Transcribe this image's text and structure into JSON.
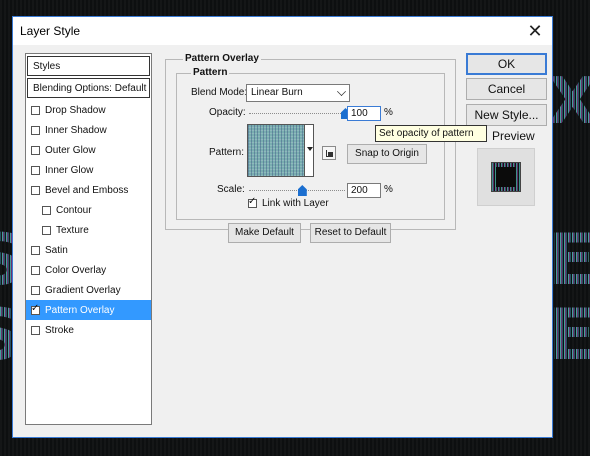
{
  "window": {
    "title": "Layer Style",
    "close_glyph": "✕"
  },
  "styles_list": {
    "header": "Styles",
    "blending_options": "Blending Options: Default",
    "items": [
      {
        "label": "Drop Shadow",
        "checked": false
      },
      {
        "label": "Inner Shadow",
        "checked": false
      },
      {
        "label": "Outer Glow",
        "checked": false
      },
      {
        "label": "Inner Glow",
        "checked": false
      },
      {
        "label": "Bevel and Emboss",
        "checked": false
      },
      {
        "label": "Contour",
        "checked": false,
        "indent": true
      },
      {
        "label": "Texture",
        "checked": false,
        "indent": true
      },
      {
        "label": "Satin",
        "checked": false
      },
      {
        "label": "Color Overlay",
        "checked": false
      },
      {
        "label": "Gradient Overlay",
        "checked": false
      },
      {
        "label": "Pattern Overlay",
        "checked": true,
        "selected": true
      },
      {
        "label": "Stroke",
        "checked": false
      }
    ]
  },
  "pattern_overlay": {
    "section_title": "Pattern Overlay",
    "group_title": "Pattern",
    "blend_mode_label": "Blend Mode:",
    "blend_mode_value": "Linear Burn",
    "opacity_label": "Opacity:",
    "opacity_value": "100",
    "opacity_unit": "%",
    "opacity_level": 1.0,
    "pattern_label": "Pattern:",
    "snap_to_origin": "Snap to Origin",
    "scale_label": "Scale:",
    "scale_value": "200",
    "scale_unit": "%",
    "scale_slider_fraction": 0.55,
    "link_with_layer": "Link with Layer",
    "link_with_layer_checked": true,
    "make_default": "Make Default",
    "reset_to_default": "Reset to Default"
  },
  "tooltip": "Set opacity of pattern",
  "right_panel": {
    "ok": "OK",
    "cancel": "Cancel",
    "new_style": "New Style...",
    "preview_label": "Preview",
    "preview_checked": true
  },
  "colors": {
    "accent": "#3a7bd5",
    "selection": "#3399ff",
    "slider_thumb": "#1b6fd0",
    "pattern_teal": "#7aaeb0"
  }
}
